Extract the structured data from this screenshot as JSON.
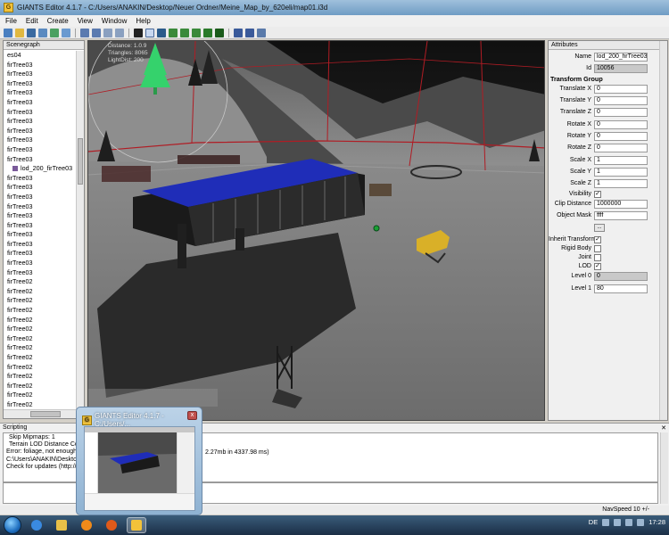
{
  "window": {
    "title": "GIANTS Editor 4.1.7 - C:/Users/ANAKIN/Desktop/Neuer Ordner/Meine_Map_by_620eli/map01.i3d",
    "app_icon_letter": "G"
  },
  "menu": [
    "File",
    "Edit",
    "Create",
    "View",
    "Window",
    "Help"
  ],
  "scenegraph": {
    "header": "Scenegraph",
    "items": [
      {
        "label": "es04",
        "child": false
      },
      {
        "label": "firTree03",
        "child": false
      },
      {
        "label": "firTree03",
        "child": false
      },
      {
        "label": "firTree03",
        "child": false
      },
      {
        "label": "firTree03",
        "child": false
      },
      {
        "label": "firTree03",
        "child": false
      },
      {
        "label": "firTree03",
        "child": false
      },
      {
        "label": "firTree03",
        "child": false
      },
      {
        "label": "firTree03",
        "child": false
      },
      {
        "label": "firTree03",
        "child": false
      },
      {
        "label": "firTree03",
        "child": false
      },
      {
        "label": "firTree03",
        "child": false
      },
      {
        "label": "lod_200_firTree03",
        "child": true
      },
      {
        "label": "firTree03",
        "child": false
      },
      {
        "label": "firTree03",
        "child": false
      },
      {
        "label": "firTree03",
        "child": false
      },
      {
        "label": "firTree03",
        "child": false
      },
      {
        "label": "firTree03",
        "child": false
      },
      {
        "label": "firTree03",
        "child": false
      },
      {
        "label": "firTree03",
        "child": false
      },
      {
        "label": "firTree03",
        "child": false
      },
      {
        "label": "firTree03",
        "child": false
      },
      {
        "label": "firTree03",
        "child": false
      },
      {
        "label": "firTree03",
        "child": false
      },
      {
        "label": "firTree02",
        "child": false
      },
      {
        "label": "firTree02",
        "child": false
      },
      {
        "label": "firTree02",
        "child": false
      },
      {
        "label": "firTree02",
        "child": false
      },
      {
        "label": "firTree02",
        "child": false
      },
      {
        "label": "firTree02",
        "child": false
      },
      {
        "label": "firTree02",
        "child": false
      },
      {
        "label": "firTree02",
        "child": false
      },
      {
        "label": "firTree02",
        "child": false
      },
      {
        "label": "firTree02",
        "child": false
      },
      {
        "label": "firTree02",
        "child": false
      },
      {
        "label": "firTree02",
        "child": false
      },
      {
        "label": "firTree02",
        "child": false
      },
      {
        "label": "firTree02",
        "child": false
      },
      {
        "label": "firTree02",
        "child": false
      },
      {
        "label": "firTree02",
        "child": false
      }
    ]
  },
  "viewport": {
    "stats": [
      "Distance: 1.0.9",
      "Triangles: 8065",
      "LightDist: 200"
    ]
  },
  "attributes": {
    "header": "Attributes",
    "name_label": "Name",
    "name_value": "lod_200_firTree03",
    "id_label": "Id",
    "id_value": "10056",
    "section": "Transform Group",
    "translate_x_label": "Translate X",
    "translate_x": "0",
    "translate_y_label": "Translate Y",
    "translate_y": "0",
    "translate_z_label": "Translate Z",
    "translate_z": "0",
    "rotate_x_label": "Rotate X",
    "rotate_x": "0",
    "rotate_y_label": "Rotate Y",
    "rotate_y": "0",
    "rotate_z_label": "Rotate Z",
    "rotate_z": "0",
    "scale_x_label": "Scale X",
    "scale_x": "1",
    "scale_y_label": "Scale Y",
    "scale_y": "1",
    "scale_z_label": "Scale Z",
    "scale_z": "1",
    "visibility_label": "Visibility",
    "visibility": true,
    "clip_distance_label": "Clip Distance",
    "clip_distance": "1000000",
    "object_mask_label": "Object Mask",
    "object_mask": "ffff",
    "more_button": "...",
    "inherit_transform_label": "Inherit Transform",
    "inherit_transform": true,
    "rigid_body_label": "Rigid Body",
    "rigid_body": false,
    "joint_label": "Joint",
    "joint": false,
    "lod_label": "LOD",
    "lod": true,
    "level0_label": "Level 0",
    "level0": "0",
    "level1_label": "Level 1",
    "level1": "80"
  },
  "scripting": {
    "header": "Scripting",
    "log": [
      "Skip Mipmaps: 1",
      "Terrain LOD Distance Coeff",
      "Error: foliage, not enough c",
      "C:\\Users\\ANAKIN\\Desktop\\N",
      "Check for updates (http://gi"
    ],
    "log_fragment": "2.27mb in 4337.98 ms)"
  },
  "statusbar": {
    "nav_speed": "NavSpeed 10 +/-"
  },
  "thumbnail": {
    "title": "GIANTS Editor 4.1.7 - C:/Users/...",
    "close_glyph": "x"
  },
  "taskbar": {
    "language": "DE",
    "time": "17:28"
  },
  "colors": {
    "roof_blue": "#1f2db8",
    "tree_green": "#35d26c",
    "terrain": "#7c7c7c",
    "boundary_red": "#b01c24",
    "tractor_yellow": "#d9b028"
  }
}
